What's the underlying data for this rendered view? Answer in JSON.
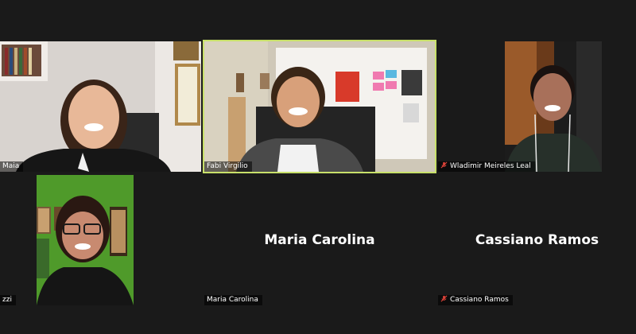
{
  "participants": [
    {
      "label": "Maia",
      "muted": false
    },
    {
      "label": "Fabi Virgilio",
      "muted": false,
      "active": true
    },
    {
      "label": "Wladimir Meireles Leal",
      "muted": true
    },
    {
      "label": "zzi",
      "muted": false
    },
    {
      "label": "Maria Carolina",
      "display_name": "Maria Carolina",
      "muted": false
    },
    {
      "label": "Cassiano Ramos",
      "display_name": "Cassiano Ramos",
      "muted": true
    }
  ],
  "colors": {
    "background": "#1a1a1a",
    "active_speaker_border": "#c8e06a",
    "muted_icon": "#e0443a",
    "label_text": "#ffffff"
  },
  "icons": {
    "muted": "mic-muted-icon"
  }
}
